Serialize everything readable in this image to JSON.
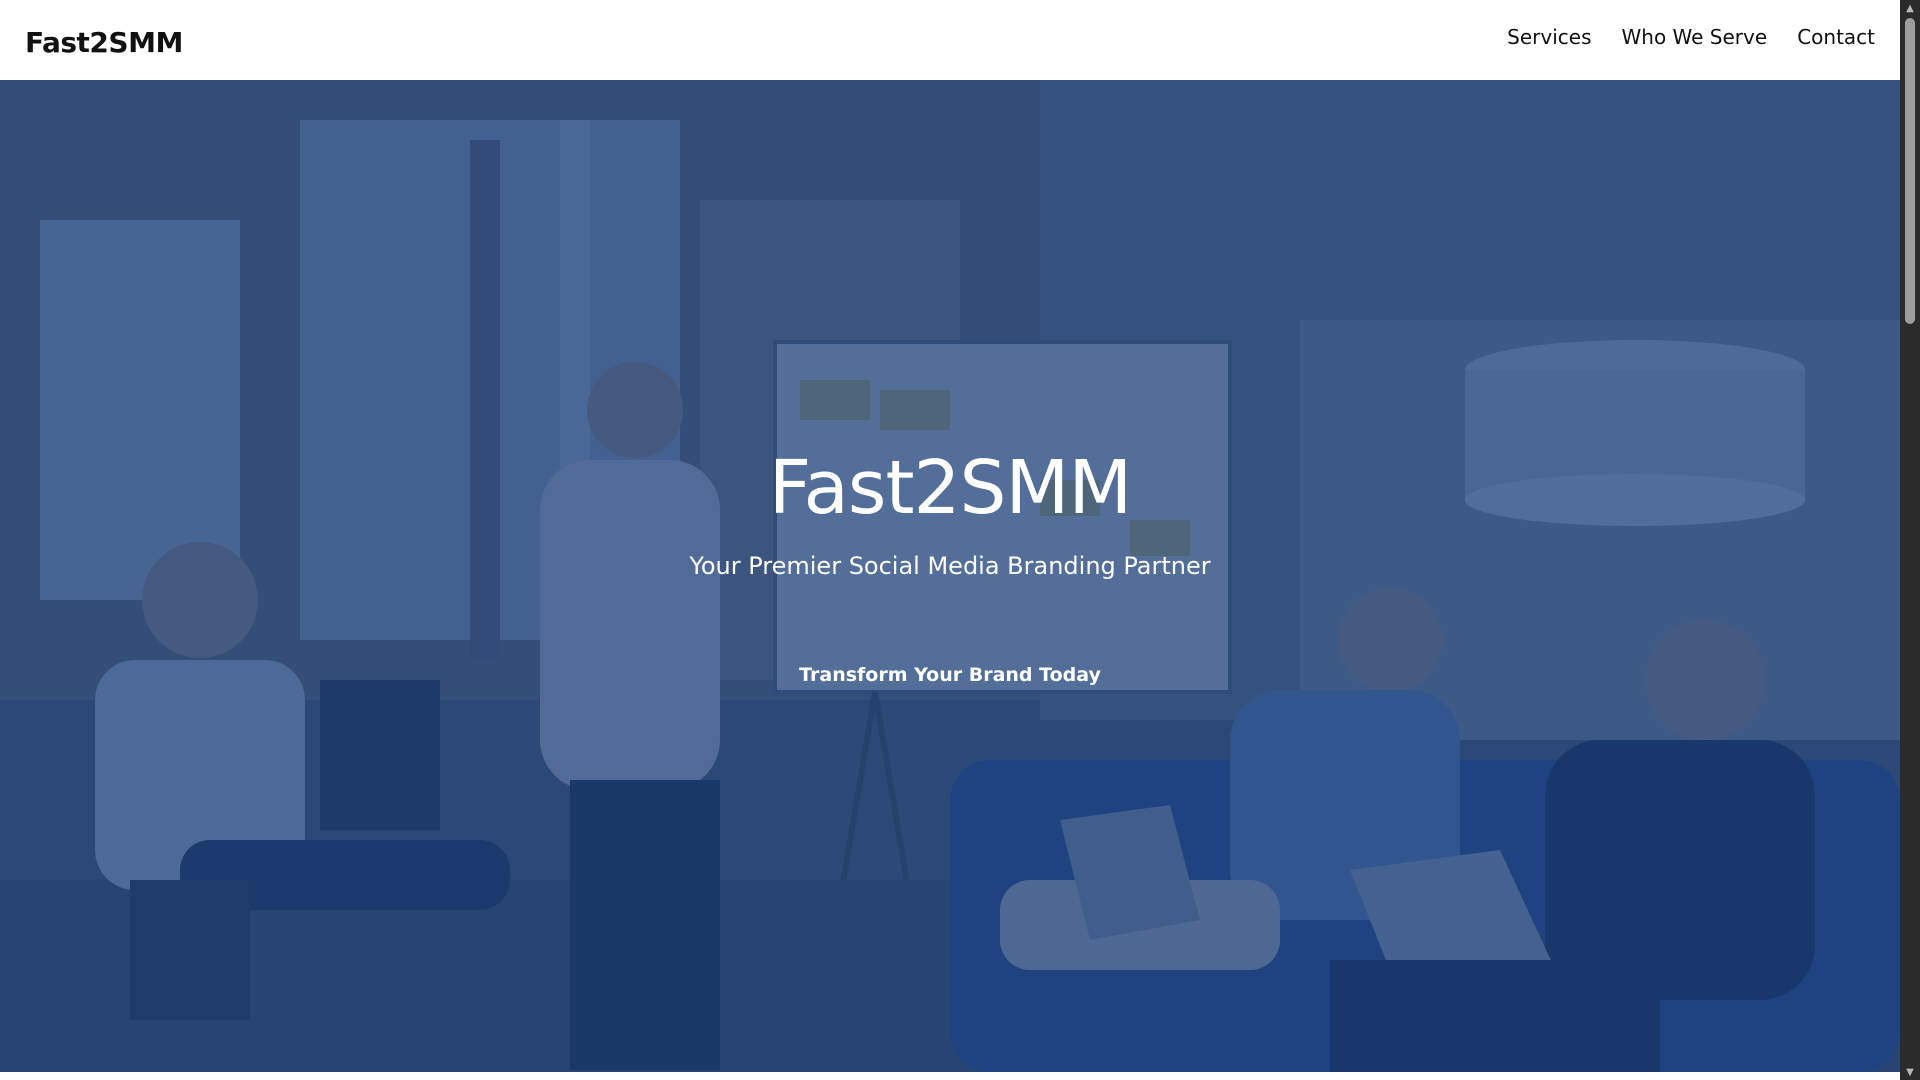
{
  "header": {
    "brand": "Fast2SMM",
    "nav": [
      {
        "label": "Services"
      },
      {
        "label": "Who We Serve"
      },
      {
        "label": "Contact"
      }
    ]
  },
  "hero": {
    "title": "Fast2SMM",
    "subtitle": "Your Premier Social Media Branding Partner",
    "cta_label": "Transform Your Brand Today",
    "background": "office-team-meeting-photo",
    "overlay_color": "#143a78"
  },
  "scrollbar": {
    "up_icon": "scroll-up-arrow-icon",
    "down_icon": "scroll-down-arrow-icon"
  }
}
